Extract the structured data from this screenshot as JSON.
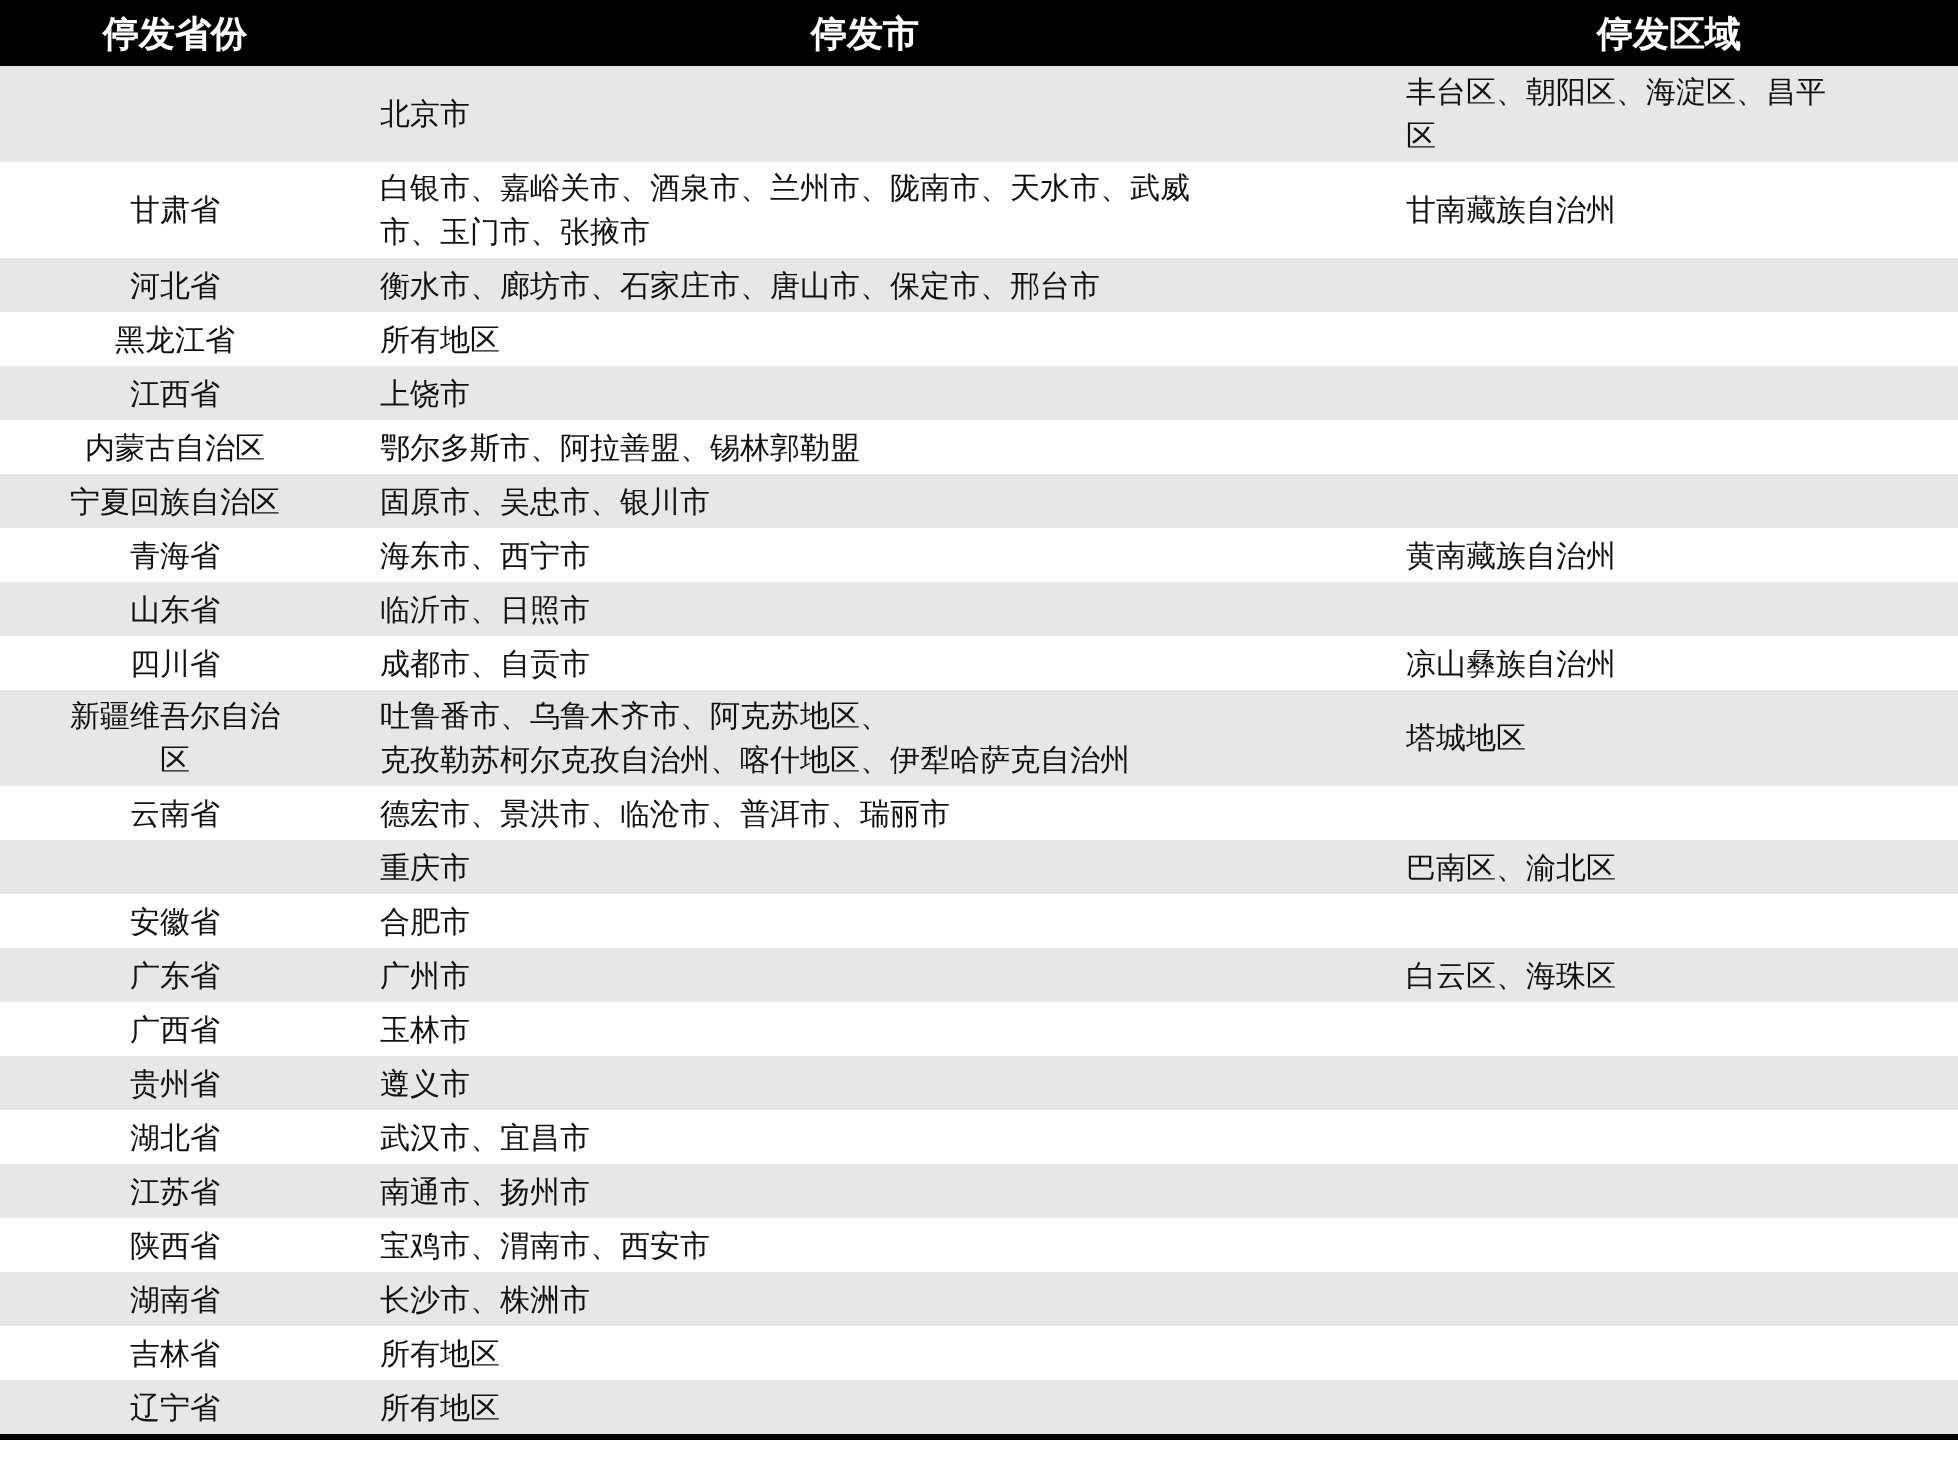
{
  "table": {
    "columns": [
      "停发省份",
      "停发市",
      "停发区域"
    ],
    "rows": [
      {
        "province": "",
        "cities": "北京市",
        "districts": "丰台区、朝阳区、海淀区、昌平区"
      },
      {
        "province": "甘肃省",
        "cities": "白银市、嘉峪关市、酒泉市、兰州市、陇南市、天水市、武威市、玉门市、张掖市",
        "districts": "甘南藏族自治州"
      },
      {
        "province": "河北省",
        "cities": "衡水市、廊坊市、石家庄市、唐山市、保定市、邢台市",
        "districts": ""
      },
      {
        "province": "黑龙江省",
        "cities": "所有地区",
        "districts": ""
      },
      {
        "province": "江西省",
        "cities": "上饶市",
        "districts": ""
      },
      {
        "province": "内蒙古自治区",
        "cities": "鄂尔多斯市、阿拉善盟、锡林郭勒盟",
        "districts": ""
      },
      {
        "province": "宁夏回族自治区",
        "cities": "固原市、吴忠市、银川市",
        "districts": ""
      },
      {
        "province": "青海省",
        "cities": "海东市、西宁市",
        "districts": "黄南藏族自治州"
      },
      {
        "province": "山东省",
        "cities": "临沂市、日照市",
        "districts": ""
      },
      {
        "province": "四川省",
        "cities": "成都市、自贡市",
        "districts": "凉山彝族自治州"
      },
      {
        "province": "新疆维吾尔自治区",
        "cities": "吐鲁番市、乌鲁木齐市、阿克苏地区、",
        "cities_more": "克孜勒苏柯尔克孜自治州、喀什地区、伊犁哈萨克自治州",
        "districts": "塔城地区"
      },
      {
        "province": "云南省",
        "cities": "德宏市、景洪市、临沧市、普洱市、瑞丽市",
        "districts": ""
      },
      {
        "province": "",
        "cities": "重庆市",
        "districts": "巴南区、渝北区"
      },
      {
        "province": "安徽省",
        "cities": "合肥市",
        "districts": ""
      },
      {
        "province": "广东省",
        "cities": "广州市",
        "districts": "白云区、海珠区"
      },
      {
        "province": "广西省",
        "cities": "玉林市",
        "districts": ""
      },
      {
        "province": "贵州省",
        "cities": "遵义市",
        "districts": ""
      },
      {
        "province": "湖北省",
        "cities": "武汉市、宜昌市",
        "districts": ""
      },
      {
        "province": "江苏省",
        "cities": "南通市、扬州市",
        "districts": ""
      },
      {
        "province": "陕西省",
        "cities": "宝鸡市、渭南市、西安市",
        "districts": ""
      },
      {
        "province": "湖南省",
        "cities": "长沙市、株洲市",
        "districts": ""
      },
      {
        "province": "吉林省",
        "cities": "所有地区",
        "districts": ""
      },
      {
        "province": "辽宁省",
        "cities": "所有地区",
        "districts": ""
      }
    ]
  }
}
